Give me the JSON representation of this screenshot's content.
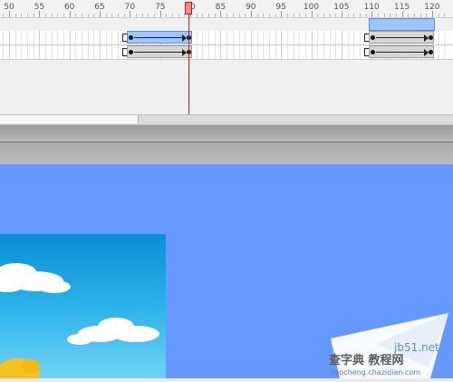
{
  "ruler": {
    "labels": [
      "50",
      "55",
      "60",
      "65",
      "70",
      "75",
      "80",
      "85",
      "90",
      "95",
      "100",
      "105",
      "110",
      "115",
      "120"
    ]
  },
  "timeline": {
    "current_frame": "80",
    "layers": [
      {
        "tween_start": 70,
        "tween_end": 80,
        "selected": true,
        "second_tween_start": 110,
        "second_tween_end": 120
      },
      {
        "tween_start": 70,
        "tween_end": 80,
        "selected": false,
        "second_tween_start": 110,
        "second_tween_end": 120
      }
    ]
  },
  "stage": {
    "background_color": "#6699ff"
  },
  "watermark": {
    "site": "jb51.net",
    "title": "查字典 教程网",
    "url": "jiaocheng.chazidian.com"
  },
  "colors": {
    "playhead": "#d01818",
    "selection": "#9ec4ff",
    "stage": "#6699ff"
  }
}
